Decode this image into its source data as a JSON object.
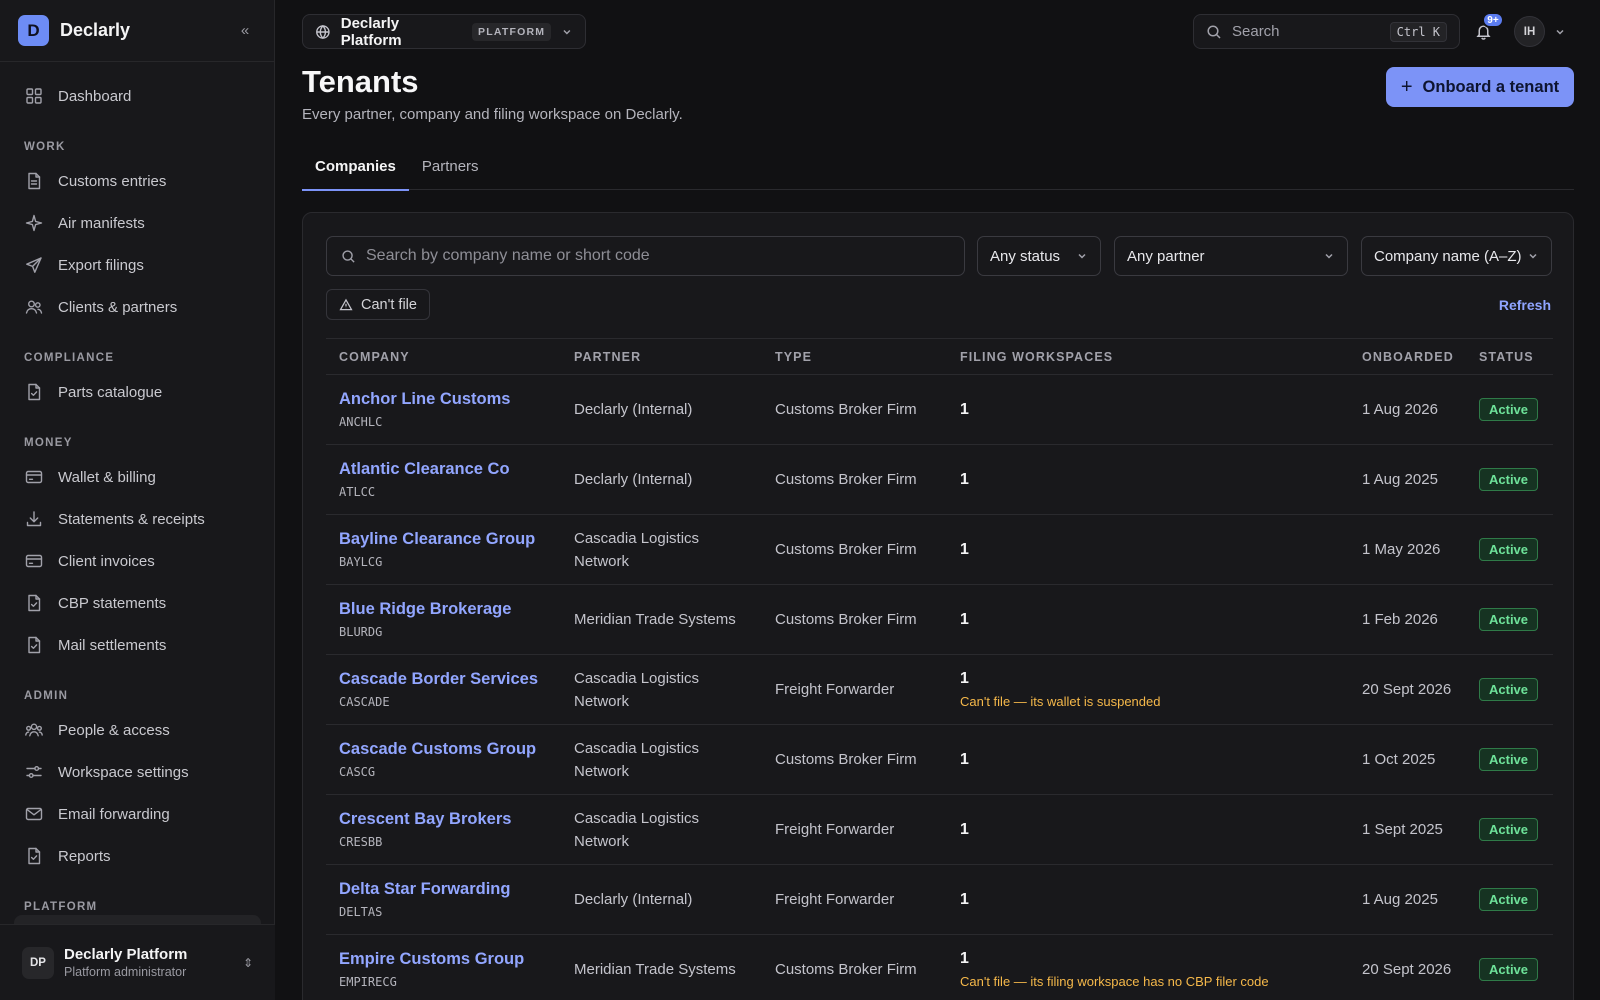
{
  "brand": {
    "logo_letter": "D",
    "name": "Declarly",
    "collapse_icon": "double-chevron-left-icon"
  },
  "nav": {
    "top": [
      {
        "label": "Dashboard",
        "icon": "grid-icon"
      }
    ],
    "sections": [
      {
        "label": "WORK",
        "items": [
          {
            "label": "Customs entries",
            "icon": "document-icon"
          },
          {
            "label": "Air manifests",
            "icon": "sparkle-icon"
          },
          {
            "label": "Export filings",
            "icon": "send-icon"
          },
          {
            "label": "Clients & partners",
            "icon": "users-icon"
          }
        ]
      },
      {
        "label": "COMPLIANCE",
        "items": [
          {
            "label": "Parts catalogue",
            "icon": "document-check-icon"
          }
        ]
      },
      {
        "label": "MONEY",
        "items": [
          {
            "label": "Wallet & billing",
            "icon": "credit-card-icon"
          },
          {
            "label": "Statements & receipts",
            "icon": "download-icon"
          },
          {
            "label": "Client invoices",
            "icon": "credit-card-icon"
          },
          {
            "label": "CBP statements",
            "icon": "document-check-icon"
          },
          {
            "label": "Mail settlements",
            "icon": "document-check-icon"
          }
        ]
      },
      {
        "label": "ADMIN",
        "items": [
          {
            "label": "People & access",
            "icon": "people-icon"
          },
          {
            "label": "Workspace settings",
            "icon": "sliders-icon"
          },
          {
            "label": "Email forwarding",
            "icon": "mail-icon"
          },
          {
            "label": "Reports",
            "icon": "document-check-icon"
          }
        ]
      },
      {
        "label": "PLATFORM",
        "items": []
      }
    ]
  },
  "sidebar_footer": {
    "initials": "DP",
    "name": "Declarly Platform",
    "role": "Platform administrator"
  },
  "topbar": {
    "workspace": {
      "name": "Declarly Platform",
      "badge": "PLATFORM"
    },
    "search": {
      "label": "Search",
      "shortcut": "Ctrl K"
    },
    "notifications": {
      "badge": "9+"
    },
    "user": {
      "initials": "IH"
    }
  },
  "page": {
    "title": "Tenants",
    "subtitle": "Every partner, company and filing workspace on Declarly.",
    "primary_action": "Onboard a tenant",
    "tabs": [
      {
        "label": "Companies",
        "active": true
      },
      {
        "label": "Partners",
        "active": false
      }
    ]
  },
  "filters": {
    "search_placeholder": "Search by company name or short code",
    "status": "Any status",
    "partner": "Any partner",
    "sort": "Company name (A–Z)",
    "chip": "Can't file",
    "refresh": "Refresh"
  },
  "table": {
    "columns": [
      "COMPANY",
      "PARTNER",
      "TYPE",
      "FILING WORKSPACES",
      "ONBOARDED",
      "STATUS"
    ],
    "rows": [
      {
        "name": "Anchor Line Customs",
        "code": "ANCHLC",
        "partner": "Declarly (Internal)",
        "type": "Customs Broker Firm",
        "workspaces": "1",
        "warning": "",
        "onboarded": "1 Aug 2026",
        "status": "Active"
      },
      {
        "name": "Atlantic Clearance Co",
        "code": "ATLCC",
        "partner": "Declarly (Internal)",
        "type": "Customs Broker Firm",
        "workspaces": "1",
        "warning": "",
        "onboarded": "1 Aug 2025",
        "status": "Active"
      },
      {
        "name": "Bayline Clearance Group",
        "code": "BAYLCG",
        "partner": "Cascadia Logistics Network",
        "type": "Customs Broker Firm",
        "workspaces": "1",
        "warning": "",
        "onboarded": "1 May 2026",
        "status": "Active"
      },
      {
        "name": "Blue Ridge Brokerage",
        "code": "BLURDG",
        "partner": "Meridian Trade Systems",
        "type": "Customs Broker Firm",
        "workspaces": "1",
        "warning": "",
        "onboarded": "1 Feb 2026",
        "status": "Active"
      },
      {
        "name": "Cascade Border Services",
        "code": "CASCADE",
        "partner": "Cascadia Logistics Network",
        "type": "Freight Forwarder",
        "workspaces": "1",
        "warning": "Can't file — its wallet is suspended",
        "onboarded": "20 Sept 2026",
        "status": "Active"
      },
      {
        "name": "Cascade Customs Group",
        "code": "CASCG",
        "partner": "Cascadia Logistics Network",
        "type": "Customs Broker Firm",
        "workspaces": "1",
        "warning": "",
        "onboarded": "1 Oct 2025",
        "status": "Active"
      },
      {
        "name": "Crescent Bay Brokers",
        "code": "CRESBB",
        "partner": "Cascadia Logistics Network",
        "type": "Freight Forwarder",
        "workspaces": "1",
        "warning": "",
        "onboarded": "1 Sept 2025",
        "status": "Active"
      },
      {
        "name": "Delta Star Forwarding",
        "code": "DELTAS",
        "partner": "Declarly (Internal)",
        "type": "Freight Forwarder",
        "workspaces": "1",
        "warning": "",
        "onboarded": "1 Aug 2025",
        "status": "Active"
      },
      {
        "name": "Empire Customs Group",
        "code": "EMPIRECG",
        "partner": "Meridian Trade Systems",
        "type": "Customs Broker Firm",
        "workspaces": "1",
        "warning": "Can't file — its filing workspace has no CBP filer code",
        "onboarded": "20 Sept 2026",
        "status": "Active"
      }
    ]
  }
}
